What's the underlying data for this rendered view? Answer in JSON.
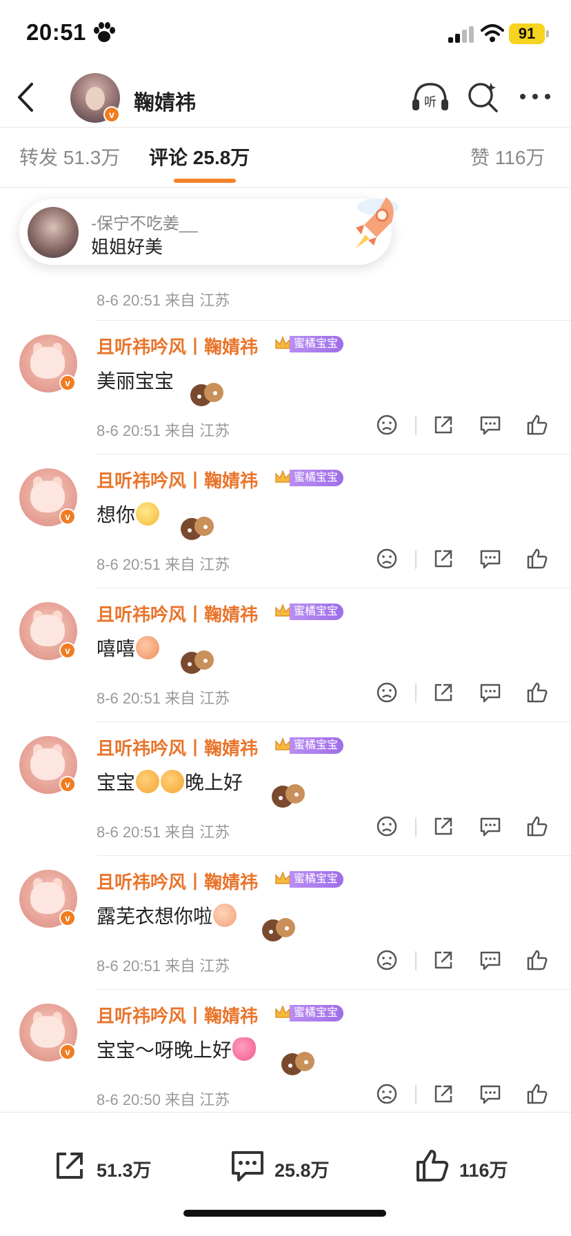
{
  "status_bar": {
    "time": "20:51",
    "battery": "91"
  },
  "header": {
    "username": "鞠婧祎",
    "verified_badge": "v"
  },
  "tabs": {
    "repost_label": "转发",
    "repost_count": "51.3万",
    "comment_label": "评论",
    "comment_count": "25.8万",
    "like_label": "赞",
    "like_count": "116万"
  },
  "toast": {
    "user": "-保宁不吃姜__",
    "text": "姐姐好美"
  },
  "top_comment_meta": "8-6 20:51 来自 江苏",
  "comments": [
    {
      "name": "且听祎吟风丨鞠婧祎",
      "badge": "蜜橘宝宝",
      "text": "美丽宝宝",
      "meta": "8-6 20:51 来自 江苏"
    },
    {
      "name": "且听祎吟风丨鞠婧祎",
      "badge": "蜜橘宝宝",
      "text": "想你",
      "meta": "8-6 20:51 来自 江苏"
    },
    {
      "name": "且听祎吟风丨鞠婧祎",
      "badge": "蜜橘宝宝",
      "text": "嘻嘻",
      "meta": "8-6 20:51 来自 江苏"
    },
    {
      "name": "且听祎吟风丨鞠婧祎",
      "badge": "蜜橘宝宝",
      "text_a": "宝宝",
      "text_b": "晚上好",
      "meta": "8-6 20:51 来自 江苏"
    },
    {
      "name": "且听祎吟风丨鞠婧祎",
      "badge": "蜜橘宝宝",
      "text": "露芜衣想你啦",
      "meta": "8-6 20:51 来自 江苏"
    },
    {
      "name": "且听祎吟风丨鞠婧祎",
      "badge": "蜜橘宝宝",
      "text": "宝宝～呀晚上好",
      "meta": "8-6 20:50 来自 江苏"
    }
  ],
  "bottom_bar": {
    "repost_count": "51.3万",
    "comment_count": "25.8万",
    "like_count": "116万"
  },
  "colors": {
    "accent": "#f5802a",
    "name": "#e9742b",
    "verified": "#f07d21",
    "badge": "#a979ec"
  },
  "icons": [
    "paw-icon",
    "signal-icon",
    "wifi-icon",
    "back-icon",
    "listen-icon",
    "search-sparkle-icon",
    "more-icon",
    "rocket-icon",
    "crown-icon",
    "dislike-icon",
    "share-icon",
    "comment-icon",
    "like-icon"
  ]
}
